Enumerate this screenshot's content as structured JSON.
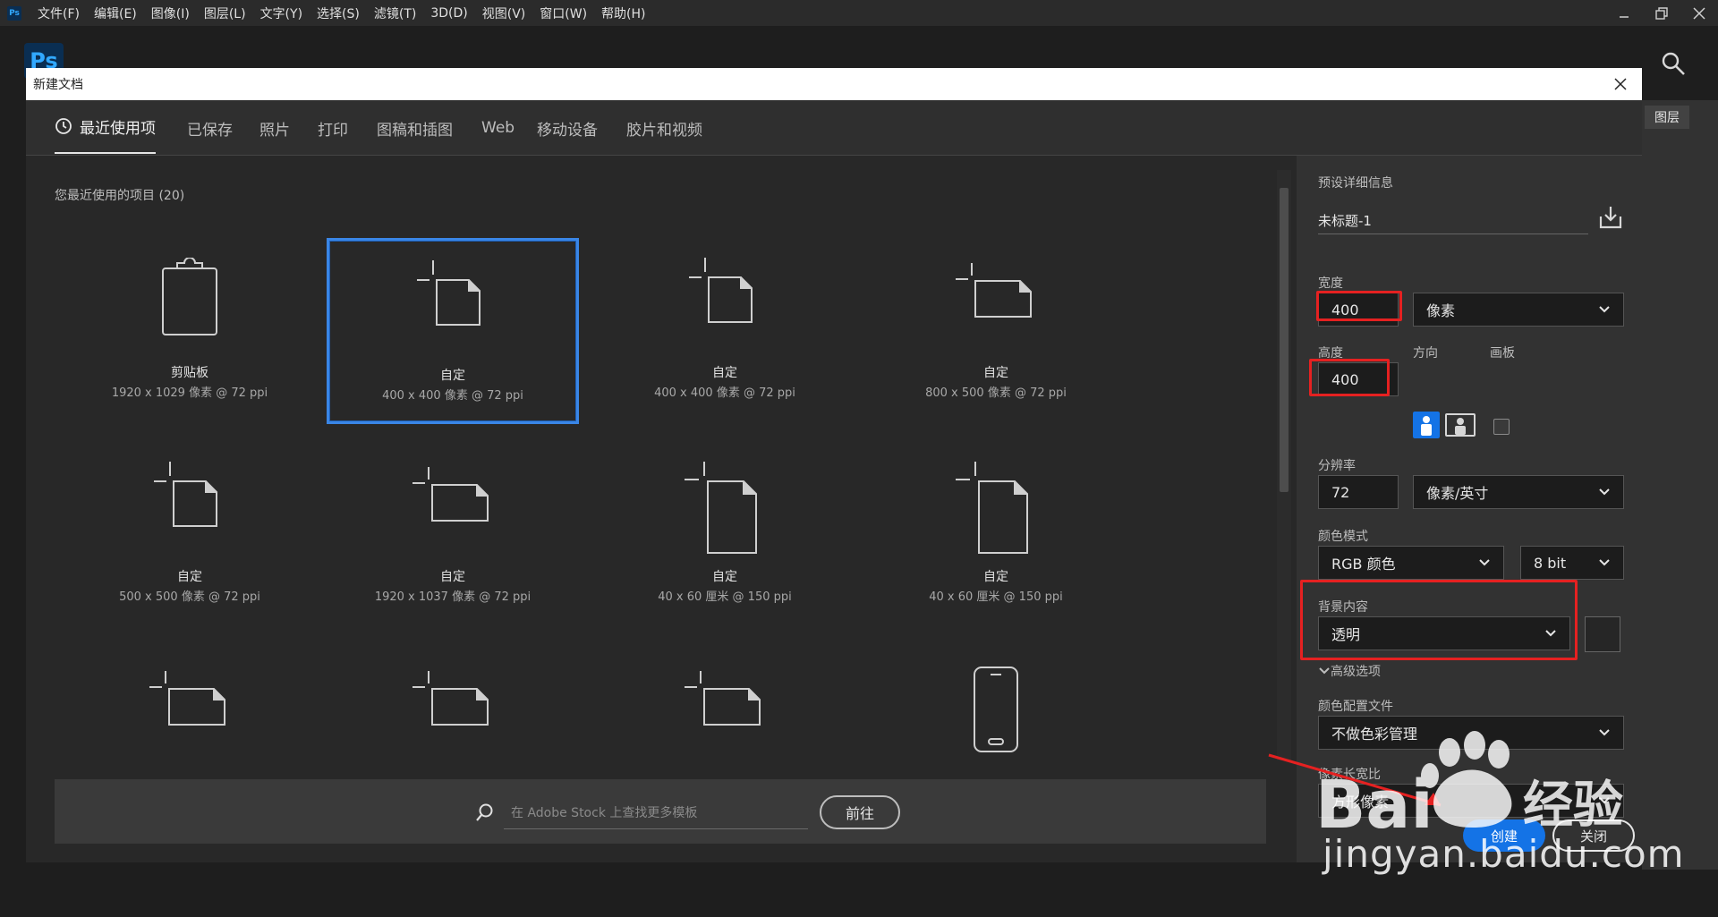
{
  "app": {
    "icon_label": "Ps"
  },
  "menu": [
    "文件(F)",
    "编辑(E)",
    "图像(I)",
    "图层(L)",
    "文字(Y)",
    "选择(S)",
    "滤镜(T)",
    "3D(D)",
    "视图(V)",
    "窗口(W)",
    "帮助(H)"
  ],
  "background": {
    "layers_tab": "图层"
  },
  "dialog": {
    "title": "新建文档",
    "tabs": [
      {
        "label": "最近使用项",
        "active": true
      },
      {
        "label": "已保存"
      },
      {
        "label": "照片"
      },
      {
        "label": "打印"
      },
      {
        "label": "图稿和插图"
      },
      {
        "label": "Web"
      },
      {
        "label": "移动设备"
      },
      {
        "label": "胶片和视频"
      }
    ],
    "recent": {
      "title": "您最近使用的项目 (20)",
      "items": [
        {
          "name": "剪贴板",
          "info": "1920 x 1029 像素 @ 72 ppi",
          "icon": "clipboard-icon"
        },
        {
          "name": "自定",
          "info": "400 x 400 像素 @ 72 ppi",
          "icon": "custom-doc-icon",
          "selected": true
        },
        {
          "name": "自定",
          "info": "400 x 400 像素 @ 72 ppi",
          "icon": "custom-doc-icon"
        },
        {
          "name": "自定",
          "info": "800 x 500 像素 @ 72 ppi",
          "icon": "landscape-doc-icon"
        },
        {
          "name": "自定",
          "info": "500 x 500 像素 @ 72 ppi",
          "icon": "custom-doc-icon"
        },
        {
          "name": "自定",
          "info": "1920 x 1037 像素 @ 72 ppi",
          "icon": "landscape-doc-icon"
        },
        {
          "name": "自定",
          "info": "40 x 60 厘米 @ 150 ppi",
          "icon": "portrait-doc-icon"
        },
        {
          "name": "自定",
          "info": "40 x 60 厘米 @ 150 ppi",
          "icon": "portrait-doc-icon"
        },
        {
          "name": "",
          "info": "",
          "icon": "landscape-doc-icon"
        },
        {
          "name": "",
          "info": "",
          "icon": "landscape-doc-icon"
        },
        {
          "name": "",
          "info": "",
          "icon": "landscape-doc-icon"
        },
        {
          "name": "",
          "info": "",
          "icon": "phone-icon"
        }
      ]
    },
    "stock": {
      "placeholder": "在 Adobe Stock 上查找更多模板",
      "go_label": "前往"
    },
    "preset": {
      "section_title": "预设详细信息",
      "doc_name": "未标题-1",
      "width_label": "宽度",
      "width_value": "400",
      "width_unit": "像素",
      "height_label": "高度",
      "height_value": "400",
      "orientation_label": "方向",
      "artboard_label": "画板",
      "resolution_label": "分辨率",
      "resolution_value": "72",
      "resolution_unit": "像素/英寸",
      "color_mode_label": "颜色模式",
      "color_mode_value": "RGB 颜色",
      "bit_depth_value": "8 bit",
      "background_label": "背景内容",
      "background_value": "透明",
      "advanced_label": "高级选项",
      "color_profile_label": "颜色配置文件",
      "color_profile_value": "不做色彩管理",
      "pixel_aspect_label": "像素长宽比",
      "pixel_aspect_value": "方形像素",
      "create_label": "创建",
      "cancel_label": "关闭"
    }
  },
  "watermark": {
    "text": "jingyan.baidu.com",
    "logo_text": "Bai 经验"
  },
  "colors": {
    "accent": "#1473e6",
    "highlight": "#e52121",
    "selection": "#3a86e6"
  }
}
